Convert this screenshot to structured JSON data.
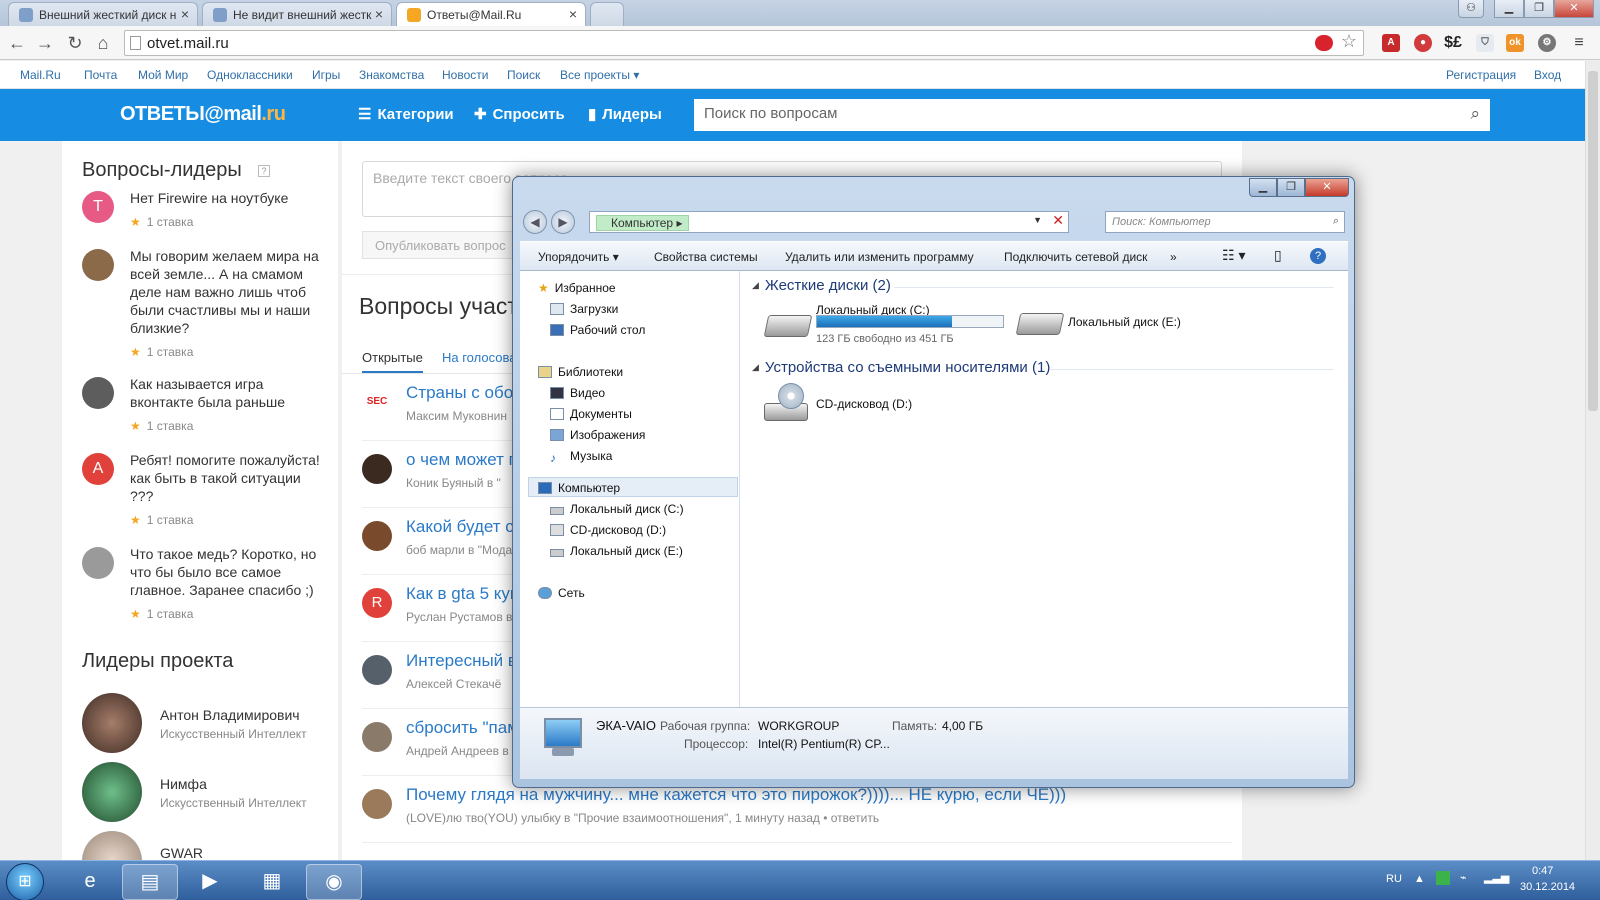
{
  "browser": {
    "tabs": [
      {
        "label": "Внешний жесткий диск н"
      },
      {
        "label": "Не видит внешний жестк"
      },
      {
        "label": "Ответы@Mail.Ru"
      }
    ],
    "url": "otvet.mail.ru"
  },
  "mailnav": {
    "left": [
      "Mail.Ru",
      "Почта",
      "Мой Мир",
      "Одноклассники",
      "Игры",
      "Знакомства",
      "Новости",
      "Поиск",
      "Все проекты ▾"
    ],
    "register": "Регистрация",
    "login": "Вход"
  },
  "header": {
    "logo_main": "ОТВЕТЫ@mail",
    "logo_ru": ".ru",
    "categories": "Категории",
    "ask": "Спросить",
    "leaders": "Лидеры",
    "search_placeholder": "Поиск по вопросам"
  },
  "sidebar": {
    "leaders_title": "Вопросы-лидеры",
    "questions": [
      {
        "avatar": "T",
        "color": "#e85a86",
        "text": "Нет Firewire на ноутбуке",
        "stake": "1 ставка"
      },
      {
        "avatar": "",
        "color": "#8b6a4a",
        "text": "Мы говорим желаем мира на всей земле... А на смамом деле нам важно лишь чтоб были счастливы мы и наши близкие?",
        "stake": "1 ставка"
      },
      {
        "avatar": "",
        "color": "#5d5d5d",
        "text": "Как называется игра вконтакте была раньше",
        "stake": "1 ставка"
      },
      {
        "avatar": "A",
        "color": "#e0413a",
        "text": "Ребят! помогите пожалуйста! как быть в такой ситуации ???",
        "stake": "1 ставка"
      },
      {
        "avatar": "",
        "color": "#9a9a9a",
        "text": "Что такое медь? Коротко, но что бы было все самое главное. Заранее спасибо ;)",
        "stake": "1 ставка"
      }
    ],
    "project_leaders_title": "Лидеры проекта",
    "project_leaders": [
      {
        "name": "Антон Владимирович",
        "rank": "Искусственный Интеллект"
      },
      {
        "name": "Нимфа",
        "rank": "Искусственный Интеллект"
      },
      {
        "name": "GWAR",
        "rank": ""
      }
    ]
  },
  "main": {
    "ask_placeholder": "Введите текст своего вопроса",
    "publish_button": "Опубликовать вопрос",
    "section_title": "Вопросы участ",
    "tab_open": "Открытые",
    "tab_vote": "На голосова",
    "items": [
      {
        "avatar": "SEC",
        "title": "Страны с обор",
        "meta": "Максим Муковнин"
      },
      {
        "avatar": "",
        "title": "о чем может п",
        "meta": "Коник Буяный в \""
      },
      {
        "avatar": "",
        "title": "Какой будет ст",
        "meta": "боб марли в \"Мода"
      },
      {
        "avatar": "R",
        "title": "Как в gta 5 куп",
        "meta": "Руслан Рустамов в"
      },
      {
        "avatar": "",
        "title": "Интересный в",
        "meta": "Алексей Стекачё"
      },
      {
        "avatar": "",
        "title": "сбросить \"пам",
        "meta": "Андрей Андреев в"
      },
      {
        "avatar": "",
        "title": "Почему глядя на мужчину... мне кажется что это пирожок?))))... НЕ курю, если ЧЁ)))",
        "meta": "(LOVE)лю тво(YOU) улыбку в \"Прочие взаимоотношения\", 1 минуту назад  •  ответить"
      }
    ]
  },
  "explorer": {
    "address": "Компьютер",
    "search_placeholder": "Поиск: Компьютер",
    "toolbar": [
      "Упорядочить ▾",
      "Свойства системы",
      "Удалить или изменить программу",
      "Подключить сетевой диск",
      "»"
    ],
    "nav": {
      "favorites": "Избранное",
      "downloads": "Загрузки",
      "desktop": "Рабочий стол",
      "libraries": "Библиотеки",
      "video": "Видео",
      "documents": "Документы",
      "images": "Изображения",
      "music": "Музыка",
      "computer": "Компьютер",
      "disk_c": "Локальный диск (C:)",
      "cd_d": "CD-дисковод (D:)",
      "disk_e": "Локальный диск (E:)",
      "network": "Сеть"
    },
    "hard_disks_title": "Жесткие диски (2)",
    "disk_c": {
      "name": "Локальный диск (C:)",
      "free": "123 ГБ свободно из 451 ГБ",
      "used_fraction": 0.727
    },
    "disk_e": {
      "name": "Локальный диск (E:)"
    },
    "removable_title": "Устройства со съемными носителями (1)",
    "cd": {
      "name": "CD-дисковод (D:)"
    },
    "details": {
      "name": "ЭКА-VAIO",
      "workgroup_label": "Рабочая группа:",
      "workgroup": "WORKGROUP",
      "memory_label": "Память:",
      "memory": "4,00 ГБ",
      "cpu_label": "Процессор:",
      "cpu": "Intel(R) Pentium(R) CP..."
    }
  },
  "taskbar": {
    "lang": "RU",
    "time": "0:47",
    "date": "30.12.2014"
  }
}
